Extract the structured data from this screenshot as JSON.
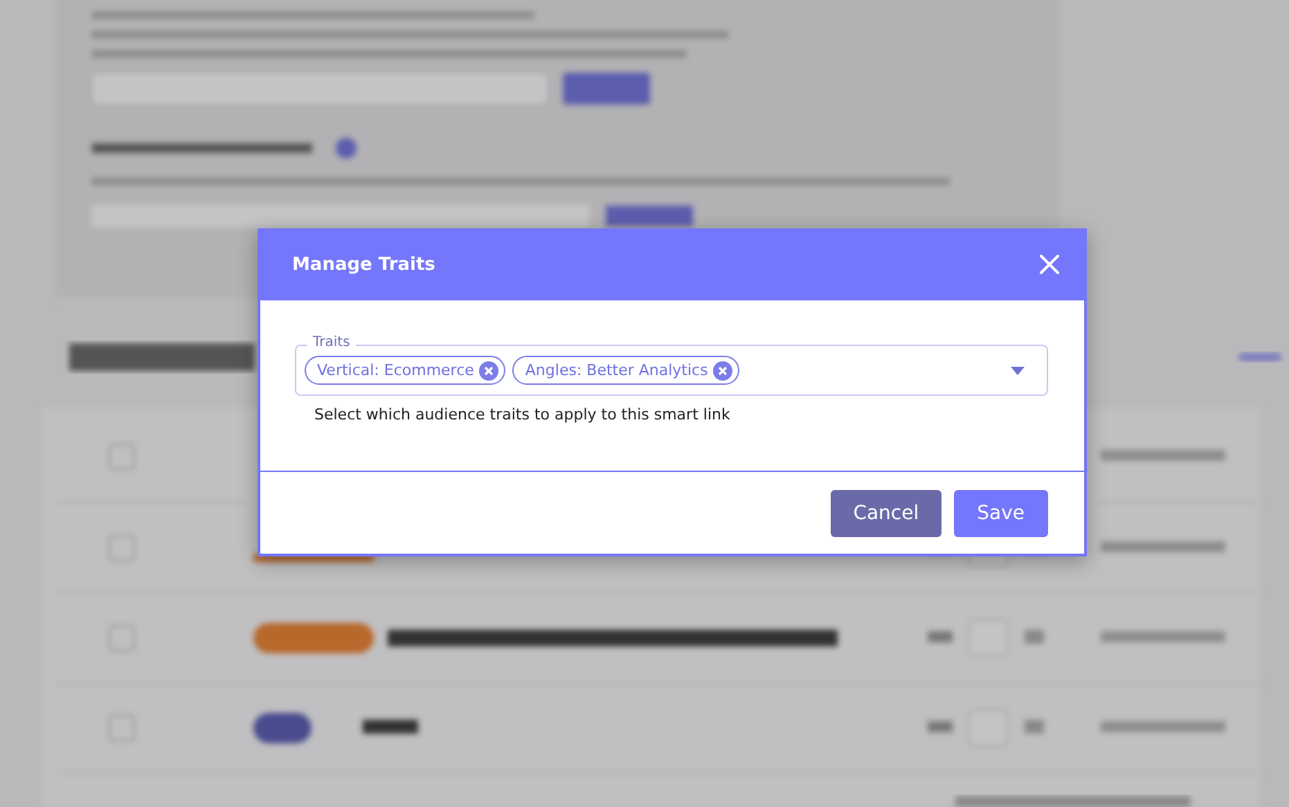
{
  "dialog": {
    "title": "Manage Traits",
    "traits_field": {
      "label": "Traits",
      "chips": [
        {
          "label": "Vertical: Ecommerce"
        },
        {
          "label": "Angles: Better Analytics"
        }
      ],
      "helper_text": "Select which audience traits to apply to this smart link"
    },
    "buttons": [
      {
        "label": "Cancel",
        "kind": "secondary"
      },
      {
        "label": "Save",
        "kind": "primary"
      }
    ]
  }
}
